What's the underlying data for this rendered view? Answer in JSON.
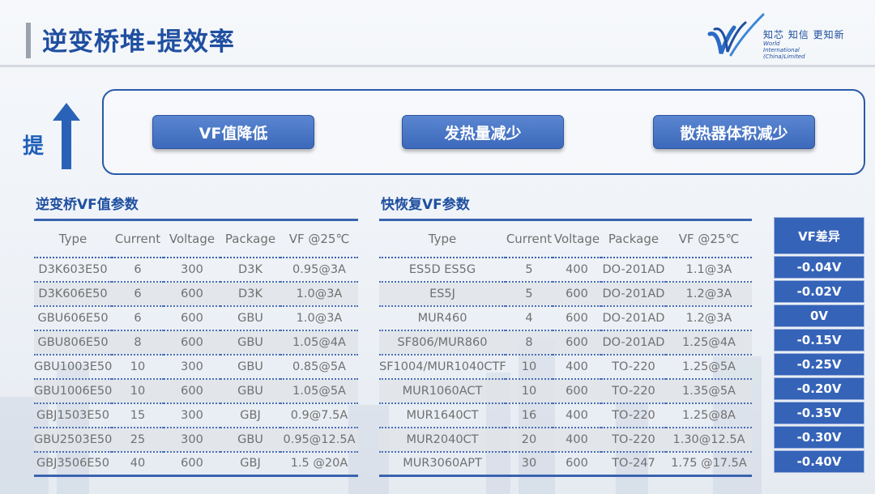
{
  "header": {
    "title": "逆变桥堆-提效率",
    "logo_slogan": "知芯  知信  更知新",
    "logo_sub": [
      "World",
      "International",
      "(China)Limited"
    ]
  },
  "indicator": {
    "label": "提"
  },
  "benefits": [
    "VF值降低",
    "发热量减少",
    "散热器体积减少"
  ],
  "left_table": {
    "title": "逆变桥VF值参数",
    "columns": [
      "Type",
      "Current",
      "Voltage",
      "Package",
      "VF @25℃"
    ],
    "rows": [
      [
        "D3K603E50",
        "6",
        "300",
        "D3K",
        "0.95@3A"
      ],
      [
        "D3K606E50",
        "6",
        "600",
        "D3K",
        "1.0@3A"
      ],
      [
        "GBU606E50",
        "6",
        "600",
        "GBU",
        "1.0@3A"
      ],
      [
        "GBU806E50",
        "8",
        "600",
        "GBU",
        "1.05@4A"
      ],
      [
        "GBU1003E50",
        "10",
        "300",
        "GBU",
        "0.85@5A"
      ],
      [
        "GBU1006E50",
        "10",
        "600",
        "GBU",
        "1.05@5A"
      ],
      [
        "GBJ1503E50",
        "15",
        "300",
        "GBJ",
        "0.9@7.5A"
      ],
      [
        "GBU2503E50",
        "25",
        "300",
        "GBU",
        "0.95@12.5A"
      ],
      [
        "GBJ3506E50",
        "40",
        "600",
        "GBJ",
        "1.5 @20A"
      ]
    ]
  },
  "right_table": {
    "title": "快恢复VF参数",
    "columns": [
      "Type",
      "Current",
      "Voltage",
      "Package",
      "VF @25℃"
    ],
    "rows": [
      [
        "ES5D ES5G",
        "5",
        "400",
        "DO-201AD",
        "1.1@3A"
      ],
      [
        "ES5J",
        "5",
        "600",
        "DO-201AD",
        "1.2@3A"
      ],
      [
        "MUR460",
        "4",
        "600",
        "DO-201AD",
        "1.2@3A"
      ],
      [
        "SF806/MUR860",
        "8",
        "600",
        "DO-201AD",
        "1.25@4A"
      ],
      [
        "SF1004/MUR1040CTF",
        "10",
        "400",
        "TO-220",
        "1.25@5A"
      ],
      [
        "MUR1060ACT",
        "10",
        "600",
        "TO-220",
        "1.35@5A"
      ],
      [
        "MUR1640CT",
        "16",
        "400",
        "TO-220",
        "1.25@8A"
      ],
      [
        "MUR2040CT",
        "20",
        "400",
        "TO-220",
        "1.30@12.5A"
      ],
      [
        "MUR3060APT",
        "30",
        "600",
        "TO-247",
        "1.75 @17.5A"
      ]
    ]
  },
  "vf_diff": {
    "title": "VF差异",
    "values": [
      "-0.04V",
      "-0.02V",
      "0V",
      "-0.15V",
      "-0.25V",
      "-0.20V",
      "-0.35V",
      "-0.30V",
      "-0.40V"
    ]
  },
  "colors": {
    "brand_blue": "#1f4fa0",
    "pill_blue": "#3c69bb",
    "table_line": "#3a63b0",
    "diff_blue": "#3563b8"
  }
}
